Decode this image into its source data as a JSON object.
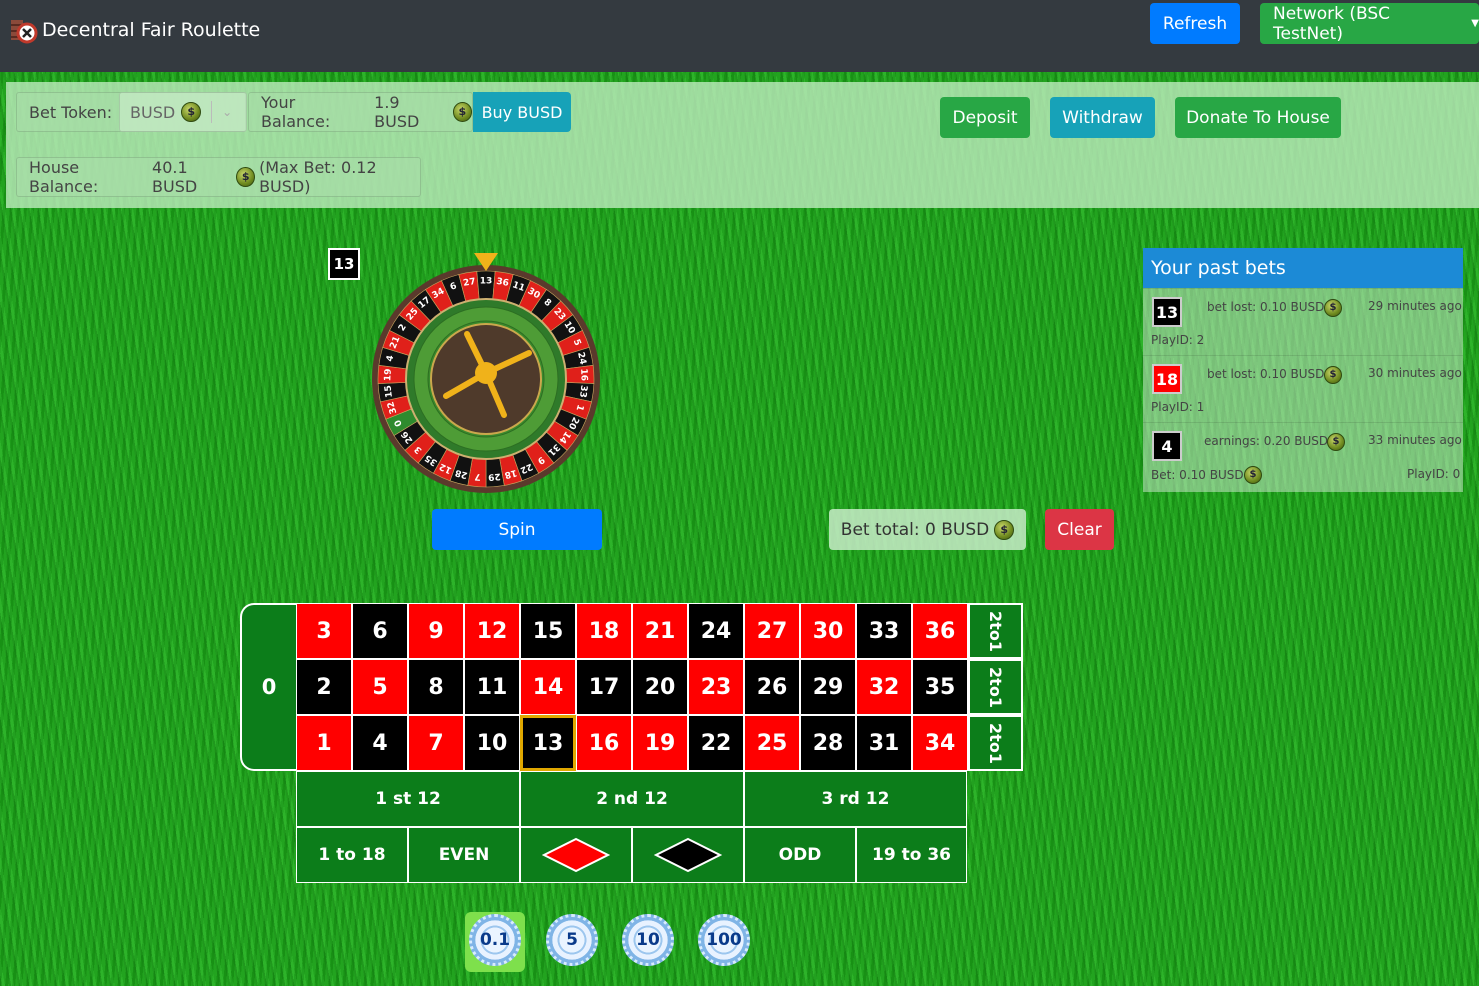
{
  "navbar": {
    "brand": "Decentral Fair Roulette",
    "refresh_label": "Refresh",
    "network_label": "Network (BSC TestNet)"
  },
  "controls": {
    "bet_token_label": "Bet Token:",
    "bet_token_value": "BUSD",
    "balance_label": "Your Balance:",
    "balance_value": "1.9 BUSD",
    "buy_label": "Buy BUSD",
    "deposit_label": "Deposit",
    "withdraw_label": "Withdraw",
    "donate_label": "Donate To House",
    "house_balance_label": "House Balance:",
    "house_balance_value": "40.1 BUSD",
    "max_bet": "(Max Bet: 0.12 BUSD)"
  },
  "wheel": {
    "last_result": "13",
    "pockets": [
      "0",
      "32",
      "15",
      "19",
      "4",
      "21",
      "2",
      "25",
      "17",
      "34",
      "6",
      "27",
      "13",
      "36",
      "11",
      "30",
      "8",
      "23",
      "10",
      "5",
      "24",
      "16",
      "33",
      "1",
      "20",
      "14",
      "31",
      "9",
      "22",
      "18",
      "29",
      "7",
      "28",
      "12",
      "35",
      "3",
      "26"
    ],
    "red_numbers": [
      1,
      3,
      5,
      7,
      9,
      12,
      14,
      16,
      18,
      19,
      21,
      23,
      25,
      27,
      30,
      32,
      34,
      36
    ]
  },
  "actions": {
    "spin_label": "Spin",
    "bet_total_label": "Bet total: 0 BUSD",
    "clear_label": "Clear"
  },
  "past_bets": {
    "title": "Your past bets",
    "items": [
      {
        "number": "13",
        "color": "black",
        "text": "bet lost: 0.10 BUSD",
        "time": "29 minutes ago",
        "play_id": "PlayID: 2",
        "bet": ""
      },
      {
        "number": "18",
        "color": "red",
        "text": "bet lost: 0.10 BUSD",
        "time": "30 minutes ago",
        "play_id": "PlayID: 1",
        "bet": ""
      },
      {
        "number": "4",
        "color": "black",
        "text": "earnings: 0.20 BUSD",
        "time": "33 minutes ago",
        "play_id": "PlayID: 0",
        "bet": "Bet: 0.10 BUSD"
      }
    ]
  },
  "board": {
    "zero": "0",
    "rows": [
      [
        {
          "n": "3",
          "c": "red"
        },
        {
          "n": "6",
          "c": "black"
        },
        {
          "n": "9",
          "c": "red"
        },
        {
          "n": "12",
          "c": "red"
        },
        {
          "n": "15",
          "c": "black"
        },
        {
          "n": "18",
          "c": "red"
        },
        {
          "n": "21",
          "c": "red"
        },
        {
          "n": "24",
          "c": "black"
        },
        {
          "n": "27",
          "c": "red"
        },
        {
          "n": "30",
          "c": "red"
        },
        {
          "n": "33",
          "c": "black"
        },
        {
          "n": "36",
          "c": "red"
        }
      ],
      [
        {
          "n": "2",
          "c": "black"
        },
        {
          "n": "5",
          "c": "red"
        },
        {
          "n": "8",
          "c": "black"
        },
        {
          "n": "11",
          "c": "black"
        },
        {
          "n": "14",
          "c": "red"
        },
        {
          "n": "17",
          "c": "black"
        },
        {
          "n": "20",
          "c": "black"
        },
        {
          "n": "23",
          "c": "red"
        },
        {
          "n": "26",
          "c": "black"
        },
        {
          "n": "29",
          "c": "black"
        },
        {
          "n": "32",
          "c": "red"
        },
        {
          "n": "35",
          "c": "black"
        }
      ],
      [
        {
          "n": "1",
          "c": "red"
        },
        {
          "n": "4",
          "c": "black"
        },
        {
          "n": "7",
          "c": "red"
        },
        {
          "n": "10",
          "c": "black"
        },
        {
          "n": "13",
          "c": "black",
          "selected": true
        },
        {
          "n": "16",
          "c": "red"
        },
        {
          "n": "19",
          "c": "red"
        },
        {
          "n": "22",
          "c": "black"
        },
        {
          "n": "25",
          "c": "red"
        },
        {
          "n": "28",
          "c": "black"
        },
        {
          "n": "31",
          "c": "black"
        },
        {
          "n": "34",
          "c": "red"
        }
      ]
    ],
    "column_label": "2to1",
    "dozens": [
      "1 st 12",
      "2 nd 12",
      "3 rd 12"
    ],
    "outside": [
      "1 to 18",
      "EVEN",
      "ODD",
      "19 to 36"
    ]
  },
  "chips": {
    "values": [
      "0.1",
      "5",
      "10",
      "100"
    ],
    "selected": "0.1"
  },
  "colors": {
    "navbar": "#343a40",
    "refresh": "#007bff",
    "network": "#28a745",
    "buy": "#17a2b8",
    "clear": "#dc3545",
    "table_green": "#0c7d1a"
  }
}
